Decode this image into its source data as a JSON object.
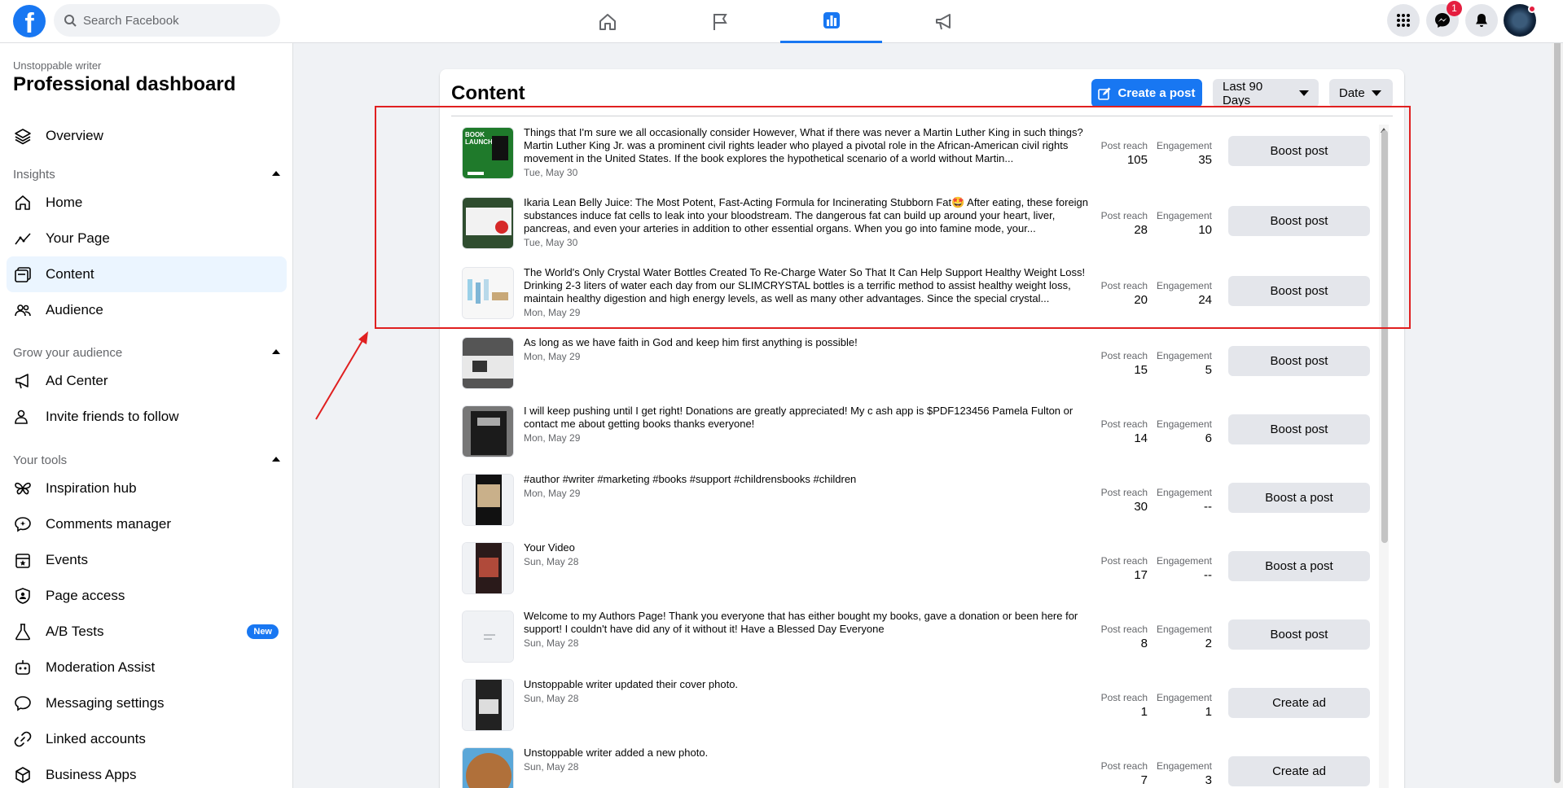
{
  "search": {
    "placeholder": "Search Facebook"
  },
  "topnav": {
    "icons": [
      "home-icon",
      "flag-icon",
      "bar-chart-icon",
      "megaphone-icon"
    ],
    "active": "bar-chart-icon"
  },
  "topright": {
    "messenger_badge": "1"
  },
  "sidebar": {
    "subtitle": "Unstoppable writer",
    "title": "Professional dashboard",
    "overview": "Overview",
    "insights_header": "Insights",
    "insights": [
      "Home",
      "Your Page",
      "Content",
      "Audience"
    ],
    "grow_header": "Grow your audience",
    "grow": [
      "Ad Center",
      "Invite friends to follow"
    ],
    "tools_header": "Your tools",
    "tools": [
      "Inspiration hub",
      "Comments manager",
      "Events",
      "Page access",
      "A/B Tests",
      "Moderation Assist",
      "Messaging settings",
      "Linked accounts",
      "Business Apps"
    ],
    "new_badge": "New"
  },
  "content": {
    "title": "Content",
    "create_post": "Create a post",
    "range": "Last 90 Days",
    "sort": "Date",
    "reach_label": "Post reach",
    "engagement_label": "Engagement",
    "posts": [
      {
        "text": "Things that I'm sure we all occasionally consider However, What if there was never a Martin Luther King in such things? Martin Luther King Jr. was a prominent civil rights leader who played a pivotal role in the African-American civil rights movement in the United States. If the book explores the hypothetical scenario of a world without Martin...",
        "date": "Tue, May 30",
        "reach": "105",
        "engagement": "35",
        "action": "Boost post"
      },
      {
        "text": "Ikaria Lean Belly Juice: The Most Potent, Fast-Acting Formula for Incinerating Stubborn Fat🤩 After eating, these foreign substances induce fat cells to leak into your bloodstream. The dangerous fat can build up around your heart, liver, pancreas, and even your arteries in addition to other essential organs. When you go into famine mode, your...",
        "date": "Tue, May 30",
        "reach": "28",
        "engagement": "10",
        "action": "Boost post"
      },
      {
        "text": "The World's Only Crystal Water Bottles Created To Re-Charge Water So That It Can Help Support Healthy Weight Loss! Drinking 2-3 liters of water each day from our SLIMCRYSTAL bottles is a terrific method to assist healthy weight loss, maintain healthy digestion and high energy levels, as well as many other advantages. Since the special crystal...",
        "date": "Mon, May 29",
        "reach": "20",
        "engagement": "24",
        "action": "Boost post"
      },
      {
        "text": "As long as we have faith in God and keep him first anything is possible!",
        "date": "Mon, May 29",
        "reach": "15",
        "engagement": "5",
        "action": "Boost post"
      },
      {
        "text": "I will keep pushing until I get right! Donations are greatly appreciated! My c ash app is $PDF123456 Pamela Fulton or contact me about getting books thanks everyone!",
        "date": "Mon, May 29",
        "reach": "14",
        "engagement": "6",
        "action": "Boost post"
      },
      {
        "text": "#author #writer #marketing #books #support #childrensbooks #children",
        "date": "Mon, May 29",
        "reach": "30",
        "engagement": "--",
        "action": "Boost a post"
      },
      {
        "text": "Your Video",
        "date": "Sun, May 28",
        "reach": "17",
        "engagement": "--",
        "action": "Boost a post"
      },
      {
        "text": "Welcome to my Authors Page! Thank you everyone that has either bought my books, gave a donation or been here for support! I couldn't have did any of it without it! Have a Blessed Day Everyone",
        "date": "Sun, May 28",
        "reach": "8",
        "engagement": "2",
        "action": "Boost post"
      },
      {
        "text": "Unstoppable writer updated their cover photo.",
        "date": "Sun, May 28",
        "reach": "1",
        "engagement": "1",
        "action": "Create ad"
      },
      {
        "text": "Unstoppable writer added a new photo.",
        "date": "Sun, May 28",
        "reach": "7",
        "engagement": "3",
        "action": "Create ad"
      }
    ]
  },
  "colors": {
    "accent": "#1877f2",
    "highlight": "#e02020",
    "active_nav_bg": "#ebf5ff"
  }
}
